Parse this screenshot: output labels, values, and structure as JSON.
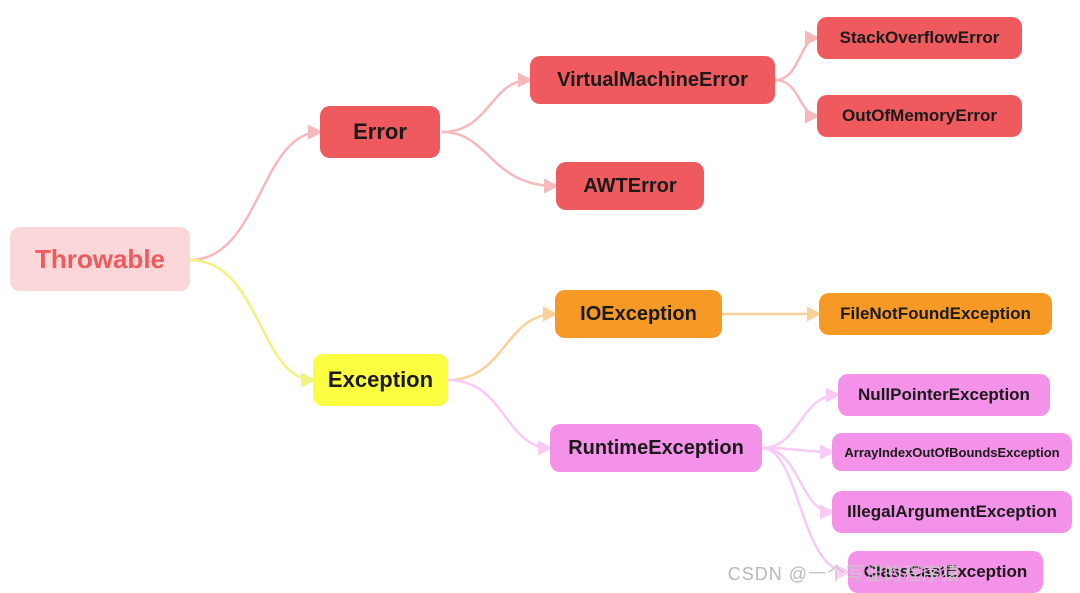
{
  "nodes": {
    "throwable": "Throwable",
    "error": "Error",
    "exception": "Exception",
    "vme": "VirtualMachineError",
    "awt": "AWTError",
    "soe": "StackOverflowError",
    "oom": "OutOfMemoryError",
    "ioex": "IOException",
    "fnf": "FileNotFoundException",
    "rtex": "RuntimeException",
    "npe": "NullPointerException",
    "aioobe": "ArrayIndexOutOfBoundsException",
    "iae": "IllegalArgumentException",
    "cce": "ClassCastException"
  },
  "colors": {
    "pinkLight": "#fbd7da",
    "red": "#ef5a5e",
    "yellow": "#faff40",
    "orange": "#f79a25",
    "magenta": "#f392e8"
  },
  "edges": [
    {
      "from": "throwable",
      "to": "error",
      "color": "red"
    },
    {
      "from": "throwable",
      "to": "exception",
      "color": "yellow"
    },
    {
      "from": "error",
      "to": "vme",
      "color": "red"
    },
    {
      "from": "error",
      "to": "awt",
      "color": "red"
    },
    {
      "from": "vme",
      "to": "soe",
      "color": "red"
    },
    {
      "from": "vme",
      "to": "oom",
      "color": "red"
    },
    {
      "from": "exception",
      "to": "ioex",
      "color": "orange"
    },
    {
      "from": "exception",
      "to": "rtex",
      "color": "magenta"
    },
    {
      "from": "ioex",
      "to": "fnf",
      "color": "orange"
    },
    {
      "from": "rtex",
      "to": "npe",
      "color": "magenta"
    },
    {
      "from": "rtex",
      "to": "aioobe",
      "color": "magenta"
    },
    {
      "from": "rtex",
      "to": "iae",
      "color": "magenta"
    },
    {
      "from": "rtex",
      "to": "cce",
      "color": "magenta"
    }
  ],
  "watermark": {
    "left": "CSDN @",
    "right": "一个写涩的程序猿"
  }
}
